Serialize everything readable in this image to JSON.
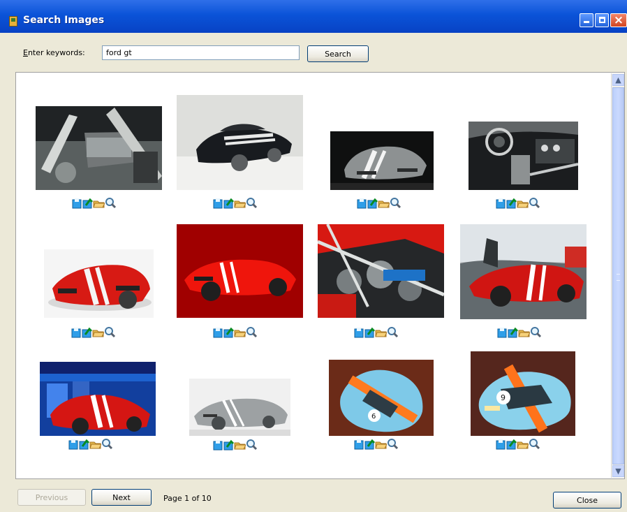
{
  "window": {
    "title": "Search Images",
    "controls": [
      "minimize-icon",
      "maximize-icon",
      "close-icon"
    ]
  },
  "search": {
    "label": "Enter keywords:",
    "value": "ford gt",
    "button_label": "Search"
  },
  "results": {
    "image_icons": [
      "save-icon",
      "insert-icon",
      "folder-icon",
      "zoom-icon"
    ],
    "thumbnails": [
      {
        "name": "engine-bay-close-up"
      },
      {
        "name": "black-ford-gt"
      },
      {
        "name": "silver-ford-gt-front"
      },
      {
        "name": "interior-dashboard"
      },
      {
        "name": "red-ford-gt-white-stripes"
      },
      {
        "name": "red-ford-gt-red-background"
      },
      {
        "name": "red-ford-gt-engine"
      },
      {
        "name": "red-ford-gt-outdoors"
      },
      {
        "name": "red-ford-gt-blue-background"
      },
      {
        "name": "silver-ford-gt-side"
      },
      {
        "name": "gulf-livery-ford-gt-top"
      },
      {
        "name": "gulf-livery-ford-gt-rear"
      }
    ]
  },
  "footer": {
    "previous_label": "Previous",
    "next_label": "Next",
    "page_text": "Page 1 of 10",
    "close_label": "Close"
  }
}
